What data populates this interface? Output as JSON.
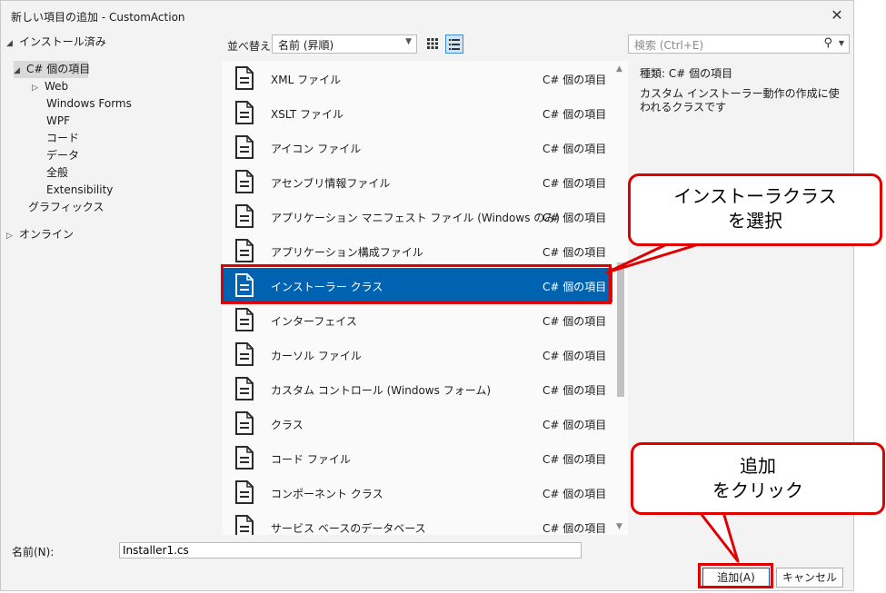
{
  "window": {
    "title": "新しい項目の追加 - CustomAction"
  },
  "tree": {
    "installed": "インストール済み",
    "csharp_items": "C# 個の項目",
    "web": "Web",
    "windows_forms": "Windows Forms",
    "wpf": "WPF",
    "code": "コード",
    "data": "データ",
    "general": "全般",
    "extensibility": "Extensibility",
    "graphics": "グラフィックス",
    "online": "オンライン"
  },
  "toolbar": {
    "sort_label": "並べ替え:",
    "sort_value": "名前 (昇順)",
    "search_placeholder": "検索 (Ctrl+E)"
  },
  "templates": [
    {
      "name": "XML ファイル",
      "language": "C# 個の項目"
    },
    {
      "name": "XSLT ファイル",
      "language": "C# 個の項目"
    },
    {
      "name": "アイコン ファイル",
      "language": "C# 個の項目"
    },
    {
      "name": "アセンブリ情報ファイル",
      "language": "C# 個の項目"
    },
    {
      "name": "アプリケーション マニフェスト ファイル (Windows のみ)",
      "language": "C# 個の項目"
    },
    {
      "name": "アプリケーション構成ファイル",
      "language": "C# 個の項目"
    },
    {
      "name": "インストーラー クラス",
      "language": "C# 個の項目",
      "selected": true
    },
    {
      "name": "インターフェイス",
      "language": "C# 個の項目"
    },
    {
      "name": "カーソル ファイル",
      "language": "C# 個の項目"
    },
    {
      "name": "カスタム コントロール (Windows フォーム)",
      "language": "C# 個の項目"
    },
    {
      "name": "クラス",
      "language": "C# 個の項目"
    },
    {
      "name": "コード ファイル",
      "language": "C# 個の項目"
    },
    {
      "name": "コンポーネント クラス",
      "language": "C# 個の項目"
    },
    {
      "name": "サービス ベースのデータベース",
      "language": "C# 個の項目"
    }
  ],
  "details": {
    "type_label": "種類:",
    "type_value": "C# 個の項目",
    "description": "カスタム インストーラー動作の作成に使われるクラスです"
  },
  "footer": {
    "name_label": "名前(N):",
    "name_value": "Installer1.cs",
    "add_label": "追加(A)",
    "cancel_label": "キャンセル"
  },
  "annotations": {
    "callout1_line1": "インストーラクラス",
    "callout1_line2": "を選択",
    "callout2_line1": "追加",
    "callout2_line2": "をクリック"
  },
  "colors": {
    "selection": "#0063b1",
    "annotation_red": "#e00000",
    "dialog_bg": "#f3f3f3"
  }
}
